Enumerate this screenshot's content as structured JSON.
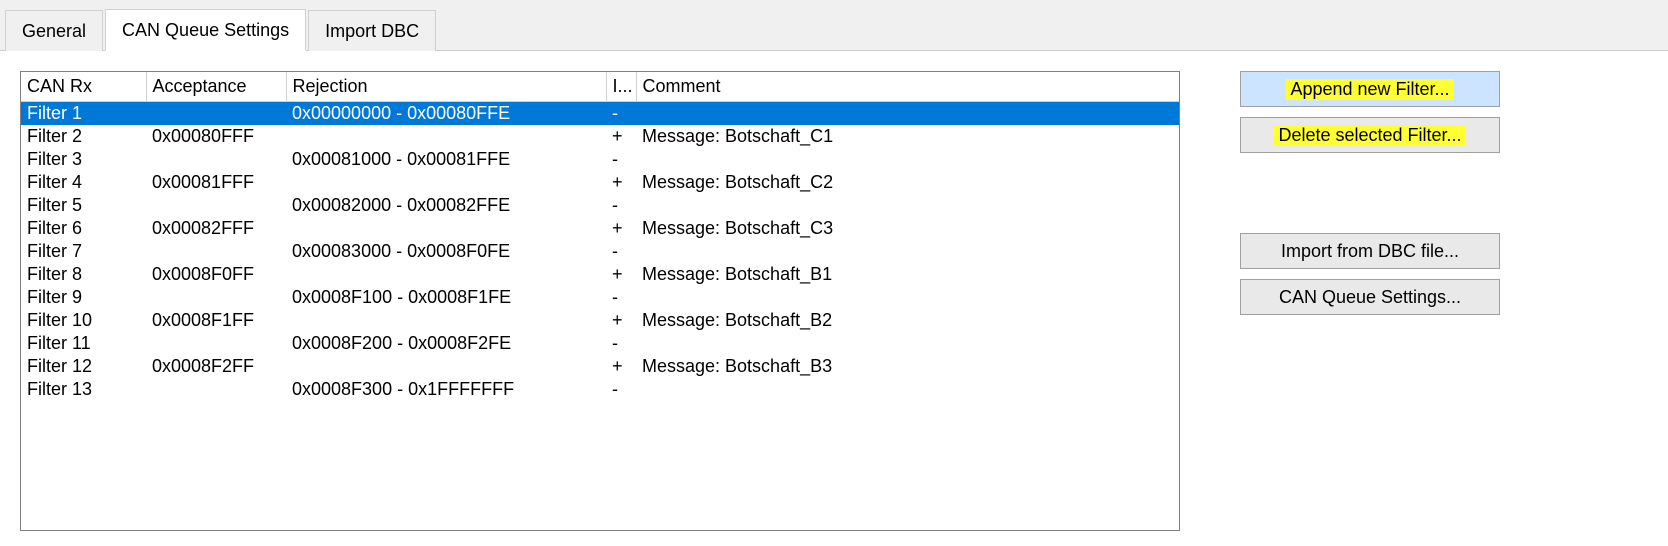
{
  "tabs": {
    "general": "General",
    "canqueue": "CAN Queue Settings",
    "importdbc": "Import DBC"
  },
  "columns": {
    "canrx": "CAN Rx",
    "acceptance": "Acceptance",
    "rejection": "Rejection",
    "i": "I...",
    "comment": "Comment"
  },
  "rows": [
    {
      "name": "Filter 1",
      "acceptance": "",
      "rejection": "0x00000000 - 0x00080FFE",
      "i": "-",
      "comment": "",
      "selected": true
    },
    {
      "name": "Filter 2",
      "acceptance": "0x00080FFF",
      "rejection": "",
      "i": "+",
      "comment": "Message:   Botschaft_C1"
    },
    {
      "name": "Filter 3",
      "acceptance": "",
      "rejection": "0x00081000 - 0x00081FFE",
      "i": "-",
      "comment": ""
    },
    {
      "name": "Filter 4",
      "acceptance": "0x00081FFF",
      "rejection": "",
      "i": "+",
      "comment": "Message:   Botschaft_C2"
    },
    {
      "name": "Filter 5",
      "acceptance": "",
      "rejection": "0x00082000 - 0x00082FFE",
      "i": "-",
      "comment": ""
    },
    {
      "name": "Filter 6",
      "acceptance": "0x00082FFF",
      "rejection": "",
      "i": "+",
      "comment": "Message:   Botschaft_C3"
    },
    {
      "name": "Filter 7",
      "acceptance": "",
      "rejection": "0x00083000 - 0x0008F0FE",
      "i": "-",
      "comment": ""
    },
    {
      "name": "Filter 8",
      "acceptance": "0x0008F0FF",
      "rejection": "",
      "i": "+",
      "comment": "Message:   Botschaft_B1"
    },
    {
      "name": "Filter 9",
      "acceptance": "",
      "rejection": "0x0008F100 - 0x0008F1FE",
      "i": "-",
      "comment": ""
    },
    {
      "name": "Filter 10",
      "acceptance": "0x0008F1FF",
      "rejection": "",
      "i": "+",
      "comment": "Message:   Botschaft_B2"
    },
    {
      "name": "Filter 11",
      "acceptance": "",
      "rejection": "0x0008F200 - 0x0008F2FE",
      "i": "-",
      "comment": ""
    },
    {
      "name": "Filter 12",
      "acceptance": "0x0008F2FF",
      "rejection": "",
      "i": "+",
      "comment": "Message:   Botschaft_B3"
    },
    {
      "name": "Filter 13",
      "acceptance": "",
      "rejection": "0x0008F300 - 0x1FFFFFFF",
      "i": "-",
      "comment": ""
    }
  ],
  "buttons": {
    "append": "Append new Filter...",
    "delete": "Delete selected Filter...",
    "importdbc": "Import from DBC file...",
    "settings": "CAN Queue Settings..."
  }
}
